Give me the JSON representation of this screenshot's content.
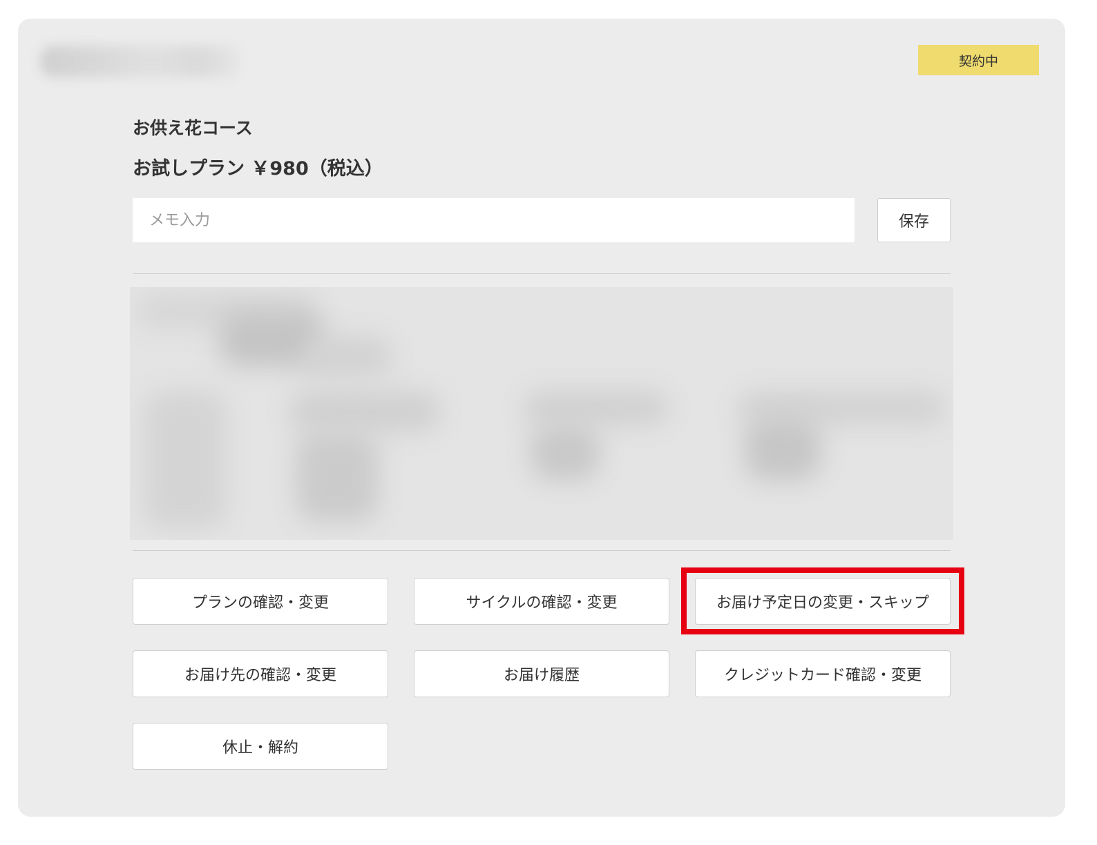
{
  "status_badge": "契約中",
  "subscription": {
    "course_title": "お供え花コース",
    "plan_price": "お試しプラン ￥980（税込）"
  },
  "memo": {
    "placeholder": "メモ入力",
    "value": "",
    "save_label": "保存"
  },
  "actions": {
    "plan_change": "プランの確認・変更",
    "cycle_change": "サイクルの確認・変更",
    "delivery_date_skip": "お届け予定日の変更・スキップ",
    "delivery_address": "お届け先の確認・変更",
    "delivery_history": "お届け履歴",
    "credit_card": "クレジットカード確認・変更",
    "pause_cancel": "休止・解約"
  },
  "colors": {
    "card_background": "#ececec",
    "badge_background": "#f0db6e",
    "highlight": "#e60012"
  }
}
